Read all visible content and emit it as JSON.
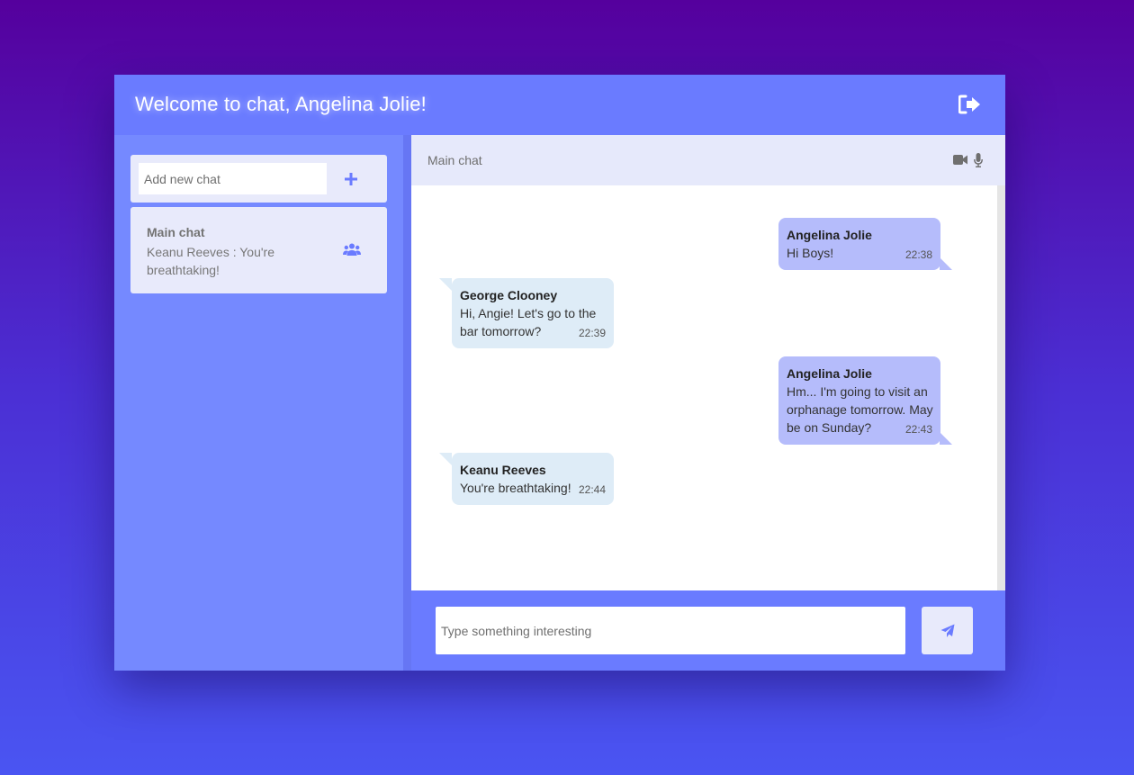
{
  "colors": {
    "accent": "#6a7bff",
    "sidebar": "#7589ff",
    "outgoing_bubble": "#b5bcfb",
    "incoming_bubble": "#deecf7"
  },
  "header": {
    "title": "Welcome to chat, Angelina Jolie!",
    "logout_icon": "sign-out-icon"
  },
  "sidebar": {
    "new_chat": {
      "placeholder": "Add new chat",
      "add_icon": "plus-icon"
    },
    "chats": [
      {
        "name": "Main chat",
        "last_message": "Keanu Reeves : You're breathtaking!",
        "icon": "users-icon"
      }
    ]
  },
  "chat": {
    "title": "Main chat",
    "icons": [
      "video-camera-icon",
      "microphone-icon"
    ],
    "messages": [
      {
        "author": "Angelina Jolie",
        "text": "Hi Boys!",
        "time": "22:38",
        "outgoing": true
      },
      {
        "author": "George Clooney",
        "text": "Hi, Angie! Let's go to the bar tomorrow?",
        "time": "22:39",
        "outgoing": false
      },
      {
        "author": "Angelina Jolie",
        "text": "Hm... I'm going to visit an orphanage tomorrow. May be on Sunday?",
        "time": "22:43",
        "outgoing": true
      },
      {
        "author": "Keanu Reeves",
        "text": "You're breathtaking!",
        "time": "22:44",
        "outgoing": false
      }
    ]
  },
  "composer": {
    "placeholder": "Type something interesting",
    "send_icon": "paper-plane-icon"
  }
}
